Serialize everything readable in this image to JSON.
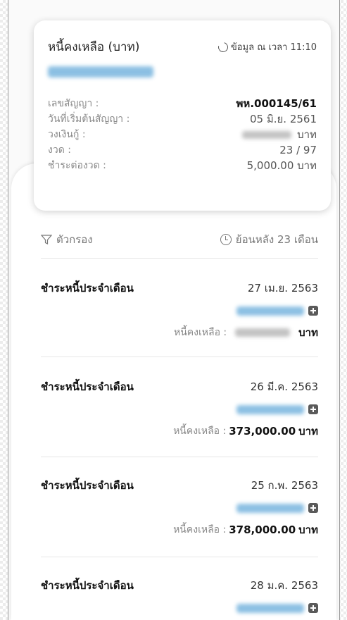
{
  "summary": {
    "title": "หนี้คงเหลือ (บาท)",
    "updated": "ข้อมูล ณ เวลา 11:10",
    "rows": [
      {
        "label": "เลขสัญญา :",
        "value": "พห.000145/61",
        "bold": true
      },
      {
        "label": "วันที่เริ่มต้นสัญญา :",
        "value": "05 มิ.ย. 2561"
      },
      {
        "label": "วงเงินกู้ :",
        "value": "บาท",
        "blurred": true
      },
      {
        "label": "งวด :",
        "value": "23 / 97"
      },
      {
        "label": "ชำระต่องวด :",
        "value": "5,000.00 บาท"
      }
    ]
  },
  "filter": {
    "filter_label": "ตัวกรอง",
    "history_label": "ย้อนหลัง 23 เดือน"
  },
  "payments": [
    {
      "title": "ชำระหนี้ประจำเดือน",
      "date": "27 เม.ย. 2563",
      "balance_label": "หนี้คงเหลือ :",
      "balance": "",
      "unit": "บาท"
    },
    {
      "title": "ชำระหนี้ประจำเดือน",
      "date": "26 มี.ค. 2563",
      "balance_label": "หนี้คงเหลือ :",
      "balance": "373,000.00",
      "unit": "บาท"
    },
    {
      "title": "ชำระหนี้ประจำเดือน",
      "date": "25 ก.พ. 2563",
      "balance_label": "หนี้คงเหลือ :",
      "balance": "378,000.00",
      "unit": "บาท"
    },
    {
      "title": "ชำระหนี้ประจำเดือน",
      "date": "28 ม.ค. 2563",
      "balance_label": "",
      "balance": "",
      "unit": ""
    }
  ]
}
